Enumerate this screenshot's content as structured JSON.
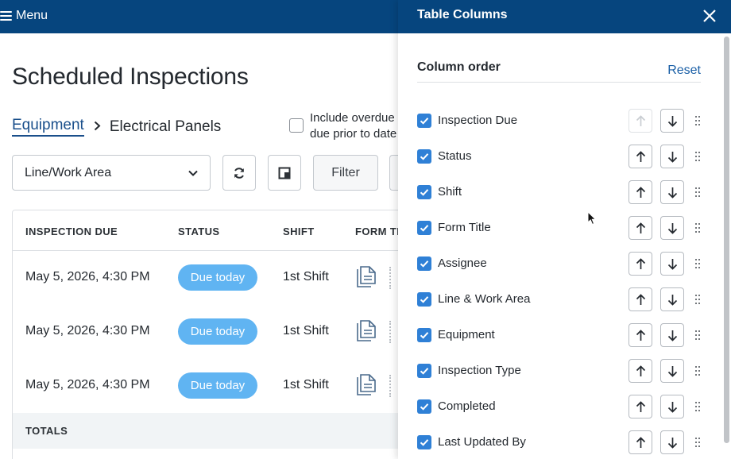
{
  "topbar": {
    "menu_label": "Menu",
    "menu_icon": "hamburger-icon"
  },
  "page": {
    "title": "Scheduled Inspections",
    "breadcrumb": {
      "link": "Equipment",
      "current": "Electrical Panels"
    },
    "overdue_option": {
      "line1": "Include overdue i",
      "line2": "due prior to date"
    }
  },
  "toolbar": {
    "line_work_area": "Line/Work Area",
    "refresh_icon": "refresh-icon",
    "layout_icon": "panel-layout-icon",
    "filter_label": "Filter"
  },
  "table": {
    "headers": [
      "INSPECTION DUE",
      "STATUS",
      "SHIFT",
      "FORM TIT"
    ],
    "rows": [
      {
        "due": "May 5, 2026, 4:30 PM",
        "status": "Due today",
        "shift": "1st Shift"
      },
      {
        "due": "May 5, 2026, 4:30 PM",
        "status": "Due today",
        "shift": "1st Shift"
      },
      {
        "due": "May 5, 2026, 4:30 PM",
        "status": "Due today",
        "shift": "1st Shift"
      }
    ],
    "totals_label": "TOTALS"
  },
  "panel": {
    "title": "Table Columns",
    "section_title": "Column order",
    "reset_label": "Reset",
    "columns": [
      {
        "label": "Inspection Due",
        "checked": true
      },
      {
        "label": "Status",
        "checked": true
      },
      {
        "label": "Shift",
        "checked": true
      },
      {
        "label": "Form Title",
        "checked": true
      },
      {
        "label": "Assignee",
        "checked": true
      },
      {
        "label": "Line & Work Area",
        "checked": true
      },
      {
        "label": "Equipment",
        "checked": true
      },
      {
        "label": "Inspection Type",
        "checked": true
      },
      {
        "label": "Completed",
        "checked": true
      },
      {
        "label": "Last Updated By",
        "checked": true
      }
    ]
  },
  "colors": {
    "header_blue": "#06457e",
    "badge_blue": "#60b4f2",
    "checkbox_blue": "#2f80d6",
    "link_blue": "#1a5fa6"
  }
}
